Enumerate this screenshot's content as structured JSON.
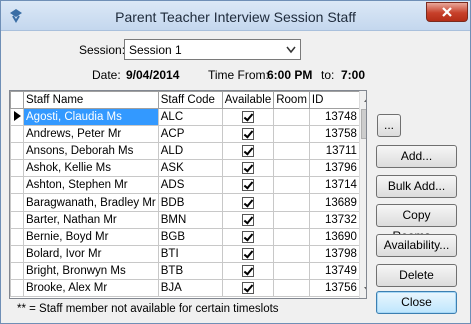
{
  "window": {
    "title": "Parent Teacher Interview Session Staff",
    "accent_color": "#3399ff"
  },
  "session": {
    "label": "Session:",
    "value": "Session 1"
  },
  "info": {
    "date_label": "Date:",
    "date_value": "9/04/2014",
    "time_from_label": "Time From:",
    "time_from_value": "6:00 PM",
    "to_label": "to:",
    "to_value": "7:00"
  },
  "grid": {
    "columns": [
      "Staff Name",
      "Staff Code",
      "Available",
      "Room",
      "ID"
    ],
    "rows": [
      {
        "name": "Agosti, Claudia Ms",
        "code": "ALC",
        "available": true,
        "room": "",
        "id": "13748"
      },
      {
        "name": "Andrews, Peter Mr",
        "code": "ACP",
        "available": true,
        "room": "",
        "id": "13758"
      },
      {
        "name": "Ansons, Deborah Ms",
        "code": "ALD",
        "available": true,
        "room": "",
        "id": "13711"
      },
      {
        "name": "Ashok, Kellie Ms",
        "code": "ASK",
        "available": true,
        "room": "",
        "id": "13796"
      },
      {
        "name": "Ashton, Stephen Mr",
        "code": "ADS",
        "available": true,
        "room": "",
        "id": "13714"
      },
      {
        "name": "Baragwanath, Bradley Mr",
        "code": "BDB",
        "available": true,
        "room": "",
        "id": "13689"
      },
      {
        "name": "Barter, Nathan Mr",
        "code": "BMN",
        "available": true,
        "room": "",
        "id": "13732"
      },
      {
        "name": "Bernie, Boyd Mr",
        "code": "BGB",
        "available": true,
        "room": "",
        "id": "13690"
      },
      {
        "name": "Bolard, Ivor Mr",
        "code": "BTI",
        "available": true,
        "room": "",
        "id": "13798"
      },
      {
        "name": "Bright, Bronwyn Ms",
        "code": "BTB",
        "available": true,
        "room": "",
        "id": "13749"
      },
      {
        "name": "Brooke, Alex Mr",
        "code": "BJA",
        "available": true,
        "room": "",
        "id": "13756"
      }
    ]
  },
  "buttons": {
    "ellipsis": "...",
    "add": "Add...",
    "bulk_add": "Bulk Add...",
    "copy_rooms": "Copy Rooms...",
    "availability": "Availability...",
    "delete": "Delete",
    "close": "Close"
  },
  "footer_note": "** = Staff member not available for certain timeslots"
}
